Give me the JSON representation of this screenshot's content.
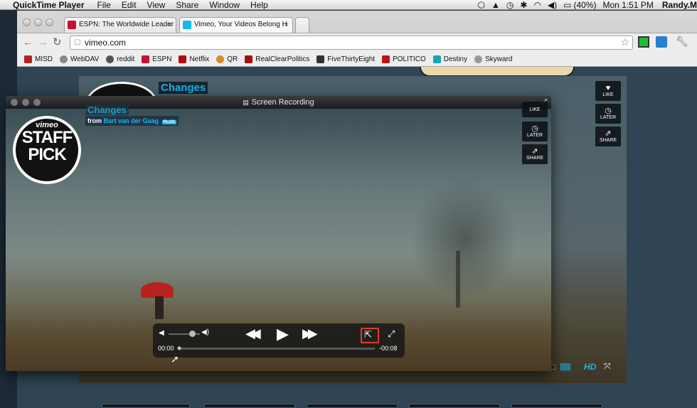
{
  "menubar": {
    "app": "QuickTime Player",
    "items": [
      "File",
      "Edit",
      "View",
      "Share",
      "Window",
      "Help"
    ],
    "battery": "(40%)",
    "clock": "Mon 1:51 PM",
    "user": "Randy.M"
  },
  "browser": {
    "tabs": [
      {
        "title": "ESPN: The Worldwide Leader",
        "color": "#c8102e"
      },
      {
        "title": "Vimeo, Your Videos Belong H",
        "color": "#1ab7ea"
      }
    ],
    "url": "vimeo.com",
    "bookmarks": [
      {
        "label": "MISD",
        "color": "#b22222"
      },
      {
        "label": "WebDAV",
        "color": "#888888"
      },
      {
        "label": "reddit",
        "color": "#555555"
      },
      {
        "label": "ESPN",
        "color": "#c8102e"
      },
      {
        "label": "Netflix",
        "color": "#b20710"
      },
      {
        "label": "QR",
        "color": "#e08a2b"
      },
      {
        "label": "RealClearPolitics",
        "color": "#a01010"
      },
      {
        "label": "FiveThirtyEight",
        "color": "#333333"
      },
      {
        "label": "POLITICO",
        "color": "#c0101a"
      },
      {
        "label": "Destiny",
        "color": "#1aa5b0"
      },
      {
        "label": "Skyward",
        "color": "#999999"
      }
    ]
  },
  "vimeo": {
    "video_title": "Changes",
    "from_label": "from",
    "author": "Bart van der Gaag",
    "author_badge": "PLUS",
    "buttons": {
      "like": "LIKE",
      "later": "LATER",
      "share": "SHARE"
    },
    "hd_label": "HD"
  },
  "quicktime": {
    "window_title": "Screen Recording",
    "staff_pick_brand": "vimeo",
    "staff_pick_line1": "STAFF",
    "staff_pick_line2": "PICK",
    "elapsed": "00:00",
    "remaining": "-00:08",
    "volume_level": 0.75,
    "icons": {
      "volume_low": "speaker-low-icon",
      "volume_high": "speaker-high-icon",
      "rewind": "rewind-icon",
      "play": "play-icon",
      "fast_forward": "fast-forward-icon",
      "share": "share-icon",
      "fullscreen": "fullscreen-icon"
    },
    "highlight_color": "#e53b2c"
  }
}
